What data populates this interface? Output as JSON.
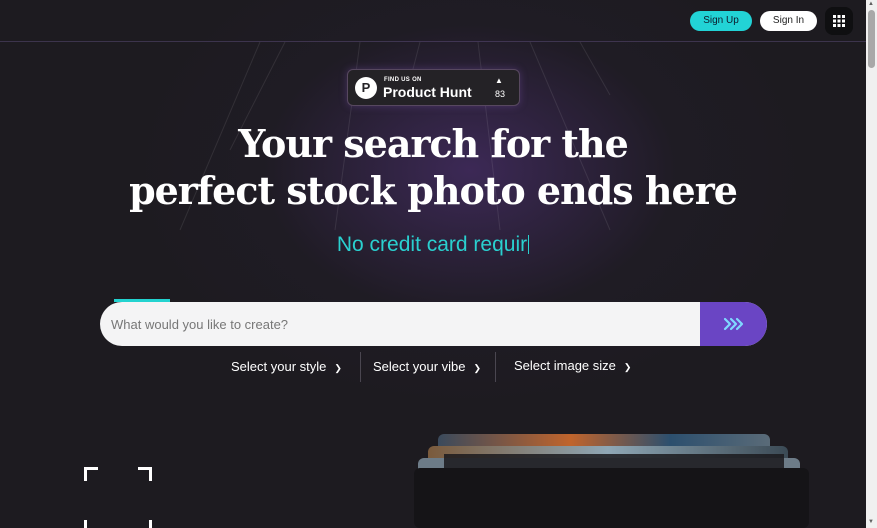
{
  "header": {
    "signup_label": "Sign Up",
    "signin_label": "Sign In",
    "menu_icon": "grid-icon"
  },
  "product_hunt": {
    "small_text": "FIND US ON",
    "name": "Product Hunt",
    "count": "83",
    "logo_letter": "P"
  },
  "hero": {
    "headline_line1": "Your search for the",
    "headline_line2": "perfect stock photo ends here",
    "tagline": "No credit card requir"
  },
  "search": {
    "placeholder": "What would you like to create?",
    "submit_icon": "chevrons-right-icon"
  },
  "filters": {
    "style_label": "Select your style",
    "vibe_label": "Select your vibe",
    "size_label": "Select image size"
  },
  "colors": {
    "accent_cyan": "#22d3d6",
    "accent_purple": "#6a45c4",
    "background": "#1c1a1f"
  }
}
